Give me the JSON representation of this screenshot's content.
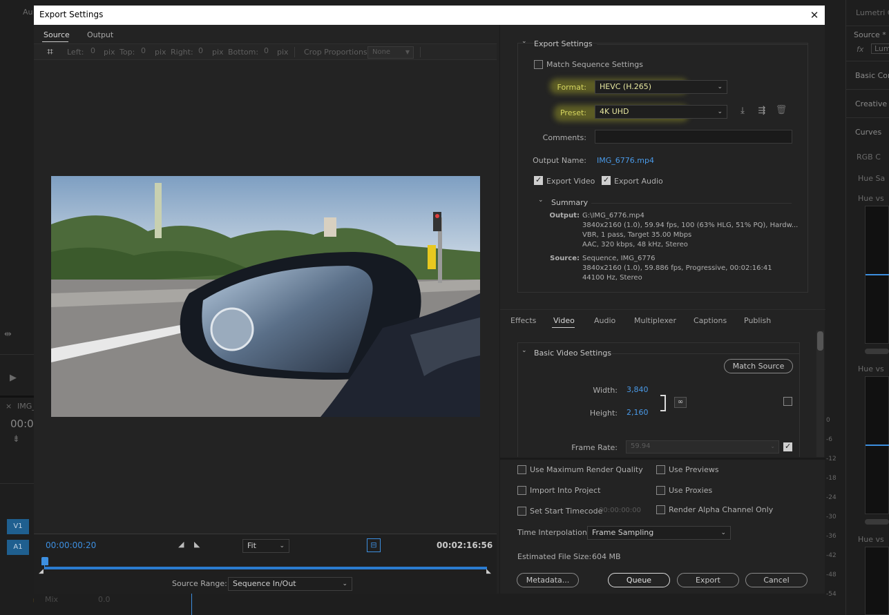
{
  "background": {
    "left_texts": [
      "Au",
      "IMG_",
      "00:0",
      "V1",
      "A1",
      "Mix",
      "0.0"
    ],
    "right_texts": [
      "Lumetri C",
      "Source * IN",
      "Lum",
      "Basic Corr",
      "Creative",
      "Curves",
      "RGB C",
      "Hue Sa",
      "Hue vs",
      "Hue vs",
      "Hue vs"
    ],
    "meter_scale": [
      "0",
      "-6",
      "-12",
      "-18",
      "-24",
      "-30",
      "-36",
      "-42",
      "-48",
      "-54"
    ]
  },
  "dialog": {
    "title": "Export Settings",
    "close_glyph": "✕"
  },
  "left": {
    "tabs": [
      {
        "label": "Source",
        "active": true
      },
      {
        "label": "Output",
        "active": false
      }
    ],
    "crop": {
      "left_label": "Left:",
      "left_value": "0",
      "top_label": "Top:",
      "top_value": "0",
      "right_label": "Right:",
      "right_value": "0",
      "bottom_label": "Bottom:",
      "bottom_value": "0",
      "unit": "pix",
      "proportions_label": "Crop Proportions:",
      "proportions_value": "None"
    },
    "transport": {
      "current_tc": "00:00:00:20",
      "zoom": "Fit",
      "duration_tc": "00:02:16:56",
      "source_range_label": "Source Range:",
      "source_range_value": "Sequence In/Out"
    }
  },
  "export_settings": {
    "header": "Export Settings",
    "match_sequence": "Match Sequence Settings",
    "format_label": "Format:",
    "format_value": "HEVC (H.265)",
    "preset_label": "Preset:",
    "preset_value": "4K UHD",
    "comments_label": "Comments:",
    "comments_value": "",
    "output_name_label": "Output Name:",
    "output_name_value": "IMG_6776.mp4",
    "export_video": "Export Video",
    "export_audio": "Export Audio",
    "summary_header": "Summary",
    "summary_output_label": "Output:",
    "summary_output_lines": [
      "G:\\IMG_6776.mp4",
      "3840x2160 (1.0), 59.94 fps, 100 (63% HLG, 51% PQ), Hardw...",
      "VBR, 1 pass, Target 35.00 Mbps",
      "AAC, 320 kbps, 48 kHz, Stereo"
    ],
    "summary_source_label": "Source:",
    "summary_source_lines": [
      "Sequence, IMG_6776",
      "3840x2160 (1.0), 59.886 fps, Progressive, 00:02:16:41",
      "44100 Hz, Stereo"
    ]
  },
  "tabs2": [
    {
      "label": "Effects",
      "active": false
    },
    {
      "label": "Video",
      "active": true
    },
    {
      "label": "Audio",
      "active": false
    },
    {
      "label": "Multiplexer",
      "active": false
    },
    {
      "label": "Captions",
      "active": false
    },
    {
      "label": "Publish",
      "active": false
    }
  ],
  "video": {
    "header": "Basic Video Settings",
    "match_source": "Match Source",
    "width_label": "Width:",
    "width_value": "3,840",
    "height_label": "Height:",
    "height_value": "2,160",
    "frame_rate_label": "Frame Rate:",
    "frame_rate_value": "59.94"
  },
  "options": {
    "max_render": "Use Maximum Render Quality",
    "use_previews": "Use Previews",
    "import_project": "Import Into Project",
    "use_proxies": "Use Proxies",
    "start_timecode": "Set Start Timecode",
    "start_timecode_value": "00:00:00:00",
    "alpha_only": "Render Alpha Channel Only",
    "time_interp_label": "Time Interpolation:",
    "time_interp_value": "Frame Sampling",
    "file_size_label": "Estimated File Size:",
    "file_size_value": "604 MB"
  },
  "buttons": {
    "metadata": "Metadata...",
    "queue": "Queue",
    "export": "Export",
    "cancel": "Cancel"
  },
  "colors": {
    "accent": "#3d8fe0",
    "highlight": "#c8c828"
  }
}
